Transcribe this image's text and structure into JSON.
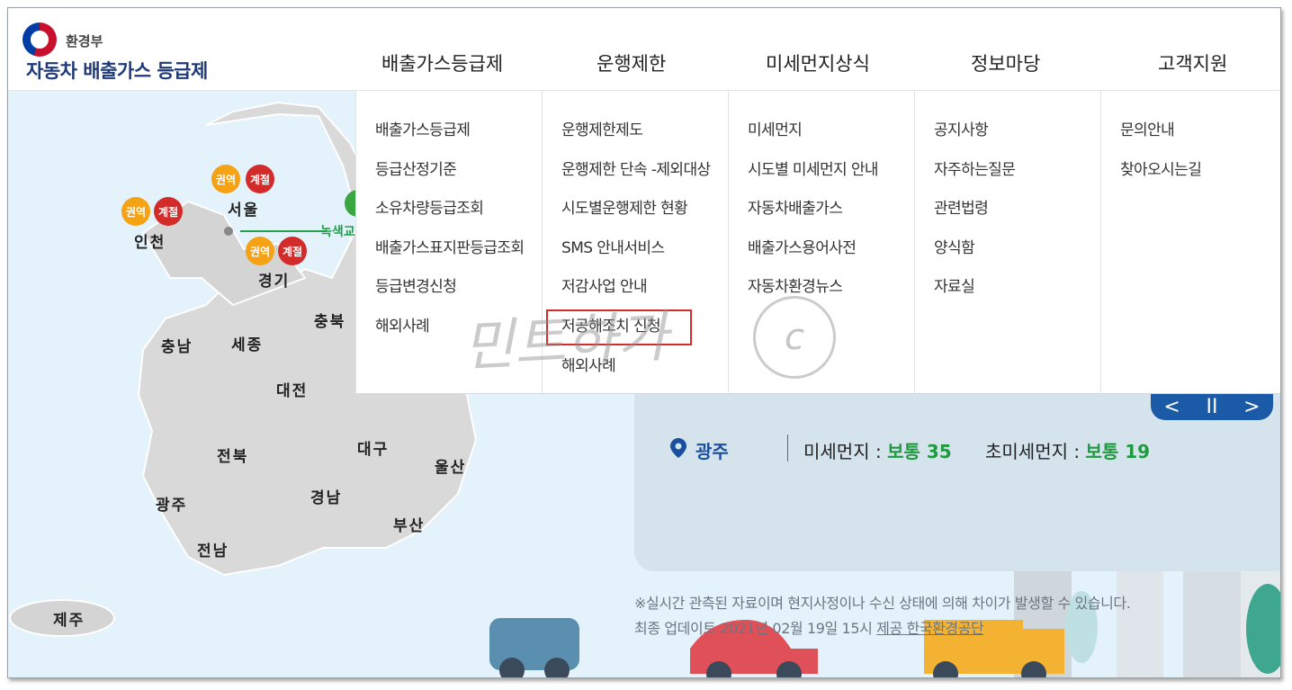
{
  "logo": {
    "ministry": "환경부",
    "title": "자동차 배출가스 등급제"
  },
  "gnb": [
    "배출가스등급제",
    "운행제한",
    "미세먼지상식",
    "정보마당",
    "고객지원"
  ],
  "dropdown": [
    [
      "배출가스등급제",
      "등급산정기준",
      "소유차량등급조회",
      "배출가스표지판등급조회",
      "등급변경신청",
      "해외사례"
    ],
    [
      "운행제한제도",
      "운행제한 단속 -제외대상",
      "시도별운행제한 현황",
      "SMS 안내서비스",
      "저감사업 안내",
      "저공해조치 신청",
      "해외사례"
    ],
    [
      "미세먼지",
      "시도별 미세먼지 안내",
      "자동차배출가스",
      "배출가스용어사전",
      "자동차환경뉴스"
    ],
    [
      "공지사항",
      "자주하는질문",
      "관련법령",
      "양식함",
      "자료실"
    ],
    [
      "문의안내",
      "찾아오시는길"
    ]
  ],
  "map": {
    "regions": [
      "인천",
      "서울",
      "경기",
      "충북",
      "충남",
      "세종",
      "대전",
      "전북",
      "대구",
      "울산",
      "광주",
      "경남",
      "부산",
      "전남",
      "제주"
    ],
    "badges": {
      "region": "권역",
      "season": "계절",
      "green": "녹"
    },
    "green_zone": "녹색교"
  },
  "air": {
    "city": "광주",
    "pm10_label": "미세먼지 :",
    "pm10_value": "보통 35",
    "pm25_label": "초미세먼지 :",
    "pm25_value": "보통 19"
  },
  "notice": "※실시간 관측된 자료이며 현지사정이나 수신 상태에 의해 차이가 발생할 수 있습니다.",
  "update_prefix": "최종 업데이트 2021년 02월 19일 15시",
  "update_source": "제공 한국환경공단",
  "controls": {
    "prev": "<",
    "pause": "II",
    "next": ">"
  },
  "watermark": {
    "text": "민트하가",
    "circle": "c"
  },
  "colors": {
    "brand": "#1e3a78",
    "good": "#1f9a3e",
    "highlight_box": "#d62b2b",
    "region_badge": "#f5a314",
    "season_badge": "#d32a2a"
  }
}
